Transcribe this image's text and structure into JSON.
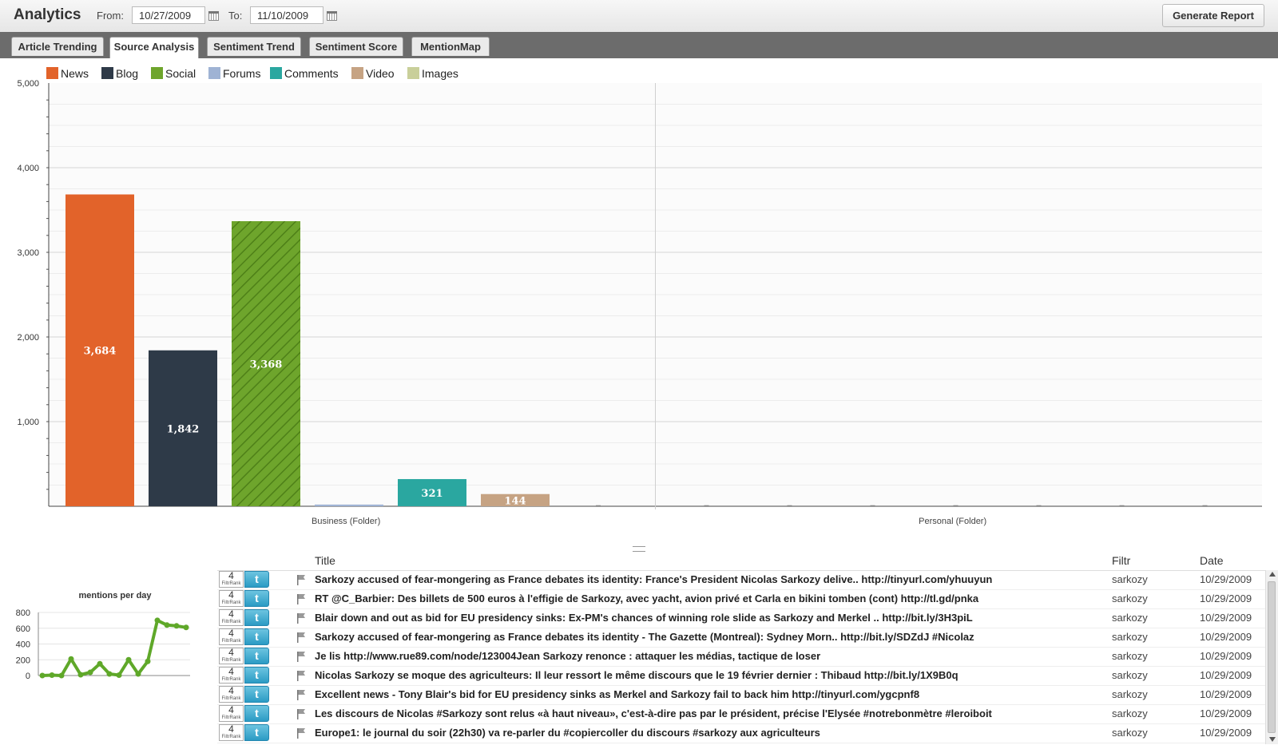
{
  "header": {
    "app_title": "Analytics",
    "from_label": "From:",
    "from_value": "10/27/2009",
    "to_label": "To:",
    "to_value": "11/10/2009",
    "generate_label": "Generate Report"
  },
  "tabs": [
    {
      "label": "Article Trending",
      "active": false
    },
    {
      "label": "Source Analysis",
      "active": true
    },
    {
      "label": "Sentiment Trend",
      "active": false
    },
    {
      "label": "Sentiment Score",
      "active": false
    },
    {
      "label": "MentionMap",
      "active": false
    }
  ],
  "chart_data": [
    {
      "type": "bar",
      "categories": [
        "Business (Folder)",
        "Personal (Folder)"
      ],
      "series": [
        {
          "name": "News",
          "color": "#e2632a",
          "values": [
            3684,
            0
          ]
        },
        {
          "name": "Blog",
          "color": "#2e3a48",
          "values": [
            1842,
            0
          ]
        },
        {
          "name": "Social",
          "color": "#6ea52c",
          "values": [
            3368,
            0
          ]
        },
        {
          "name": "Forums",
          "color": "#9fb3d4",
          "values": [
            20,
            0
          ]
        },
        {
          "name": "Comments",
          "color": "#2aa7a0",
          "values": [
            321,
            0
          ]
        },
        {
          "name": "Video",
          "color": "#c6a383",
          "values": [
            144,
            0
          ]
        },
        {
          "name": "Images",
          "color": "#c9cf9a",
          "values": [
            0,
            0
          ]
        }
      ],
      "data_labels": [
        "3,684",
        "1,842",
        "3,368",
        "321",
        "144"
      ],
      "ylim": [
        0,
        5000
      ],
      "yticks": [
        "5,000",
        "4,000",
        "3,000",
        "2,000",
        "1,000"
      ],
      "grid": true,
      "legend": "top-left"
    },
    {
      "type": "line",
      "title": "mentions per day",
      "ylim": [
        0,
        800
      ],
      "yticks": [
        "800",
        "600",
        "400",
        "200",
        "0"
      ],
      "series": [
        {
          "color": "#5fa829",
          "values": [
            0,
            5,
            0,
            210,
            10,
            40,
            150,
            20,
            5,
            200,
            20,
            180,
            700,
            640,
            630,
            610
          ]
        }
      ]
    }
  ],
  "table": {
    "headers": {
      "title": "Title",
      "filtr": "Filtr",
      "date": "Date"
    },
    "rank_sub": "FiltrRank",
    "twitter_glyph": "t",
    "rows": [
      {
        "rank": "4",
        "title": "Sarkozy accused of fear-mongering as France debates its identity: France's President Nicolas Sarkozy delive.. http://tinyurl.com/yhuuyun",
        "filtr": "sarkozy",
        "date": "10/29/2009"
      },
      {
        "rank": "4",
        "title": "RT @C_Barbier: Des billets de 500 euros à l'effigie de Sarkozy, avec yacht, avion privé et Carla en bikini tomben (cont) http://tl.gd/pnka",
        "filtr": "sarkozy",
        "date": "10/29/2009"
      },
      {
        "rank": "4",
        "title": "Blair down and out as bid for EU presidency sinks: Ex-PM's chances of winning role slide as Sarkozy and Merkel .. http://bit.ly/3H3piL",
        "filtr": "sarkozy",
        "date": "10/29/2009"
      },
      {
        "rank": "4",
        "title": "Sarkozy accused of fear-mongering as France debates its identity - The Gazette (Montreal): Sydney Morn.. http://bit.ly/SDZdJ #Nicolaz",
        "filtr": "sarkozy",
        "date": "10/29/2009"
      },
      {
        "rank": "4",
        "title": "Je lis http://www.rue89.com/node/123004Jean Sarkozy renonce : attaquer les médias, tactique de loser",
        "filtr": "sarkozy",
        "date": "10/29/2009"
      },
      {
        "rank": "4",
        "title": "Nicolas Sarkozy se moque des agriculteurs: Il leur ressort le même discours que le 19 février dernier : Thibaud http://bit.ly/1X9B0q",
        "filtr": "sarkozy",
        "date": "10/29/2009"
      },
      {
        "rank": "4",
        "title": "Excellent news - Tony Blair's bid for EU presidency sinks as Merkel and Sarkozy fail to back him http://tinyurl.com/ygcpnf8",
        "filtr": "sarkozy",
        "date": "10/29/2009"
      },
      {
        "rank": "4",
        "title": "Les discours de Nicolas #Sarkozy sont relus «à haut niveau», c'est-à-dire pas par le président, précise l'Elysée #notrebonmètre #leroiboit",
        "filtr": "sarkozy",
        "date": "10/29/2009"
      },
      {
        "rank": "4",
        "title": "Europe1: le journal du soir (22h30) va re-parler du #copiercoller du discours #sarkozy aux agriculteurs",
        "filtr": "sarkozy",
        "date": "10/29/2009"
      }
    ]
  }
}
